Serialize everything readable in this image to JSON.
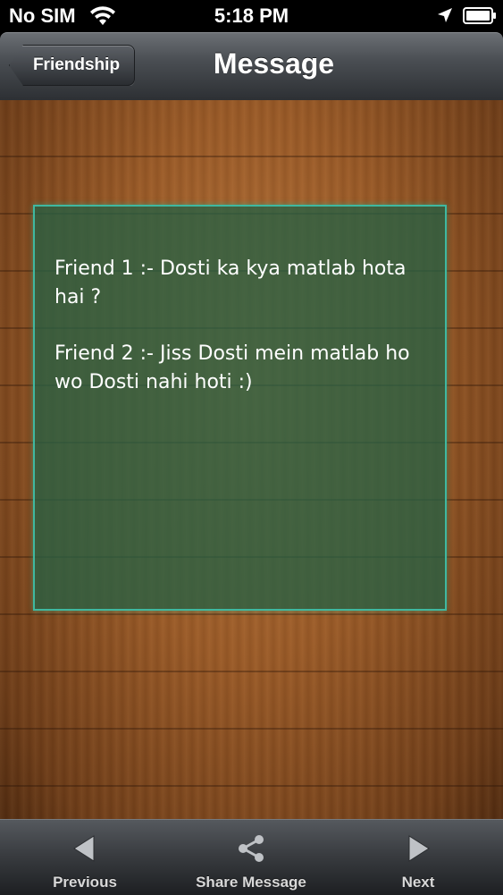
{
  "status_bar": {
    "carrier": "No SIM",
    "time": "5:18 PM",
    "wifi_icon": "wifi-icon",
    "location_icon": "location-arrow-icon",
    "battery_icon": "battery-icon"
  },
  "nav_bar": {
    "back_label": "Friendship",
    "title": "Message"
  },
  "message": {
    "lines": [
      "Friend 1 :- Dosti ka kya matlab hota hai ?",
      "Friend 2 :- Jiss Dosti mein matlab ho wo Dosti nahi hoti :)"
    ]
  },
  "toolbar": {
    "previous_label": "Previous",
    "share_label": "Share Message",
    "next_label": "Next"
  },
  "colors": {
    "panel_border": "#3fb8a0",
    "panel_fill": "#266044",
    "wood": "#9a5a27"
  }
}
